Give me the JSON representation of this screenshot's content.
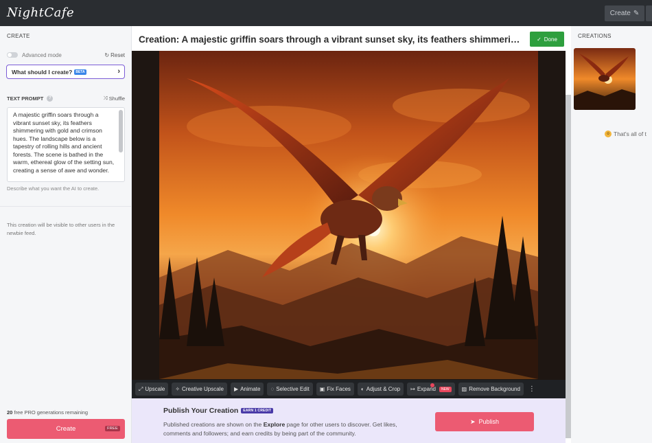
{
  "header": {
    "logo": "NightCafe",
    "create_label": "Create"
  },
  "left_panel": {
    "section_label": "CREATE",
    "advanced_mode_label": "Advanced mode",
    "reset_label": "Reset",
    "what_should_i_create_label": "What should I create?",
    "beta_badge": "BETA",
    "text_prompt_label": "TEXT PROMPT",
    "shuffle_label": "Shuffle",
    "prompt_text": "A majestic griffin soars through a vibrant sunset sky, its feathers shimmering with gold and crimson hues. The landscape below is a tapestry of rolling hills and ancient forests. The scene is bathed in the warm, ethereal glow of the setting sun, creating a sense of awe and wonder.",
    "prompt_hint": "Describe what you want the AI to create.",
    "visibility_note": "This creation will be visible to other users in the newbie feed.",
    "remaining_count": "20",
    "remaining_text": "free PRO generations remaining",
    "create_button_label": "Create",
    "free_tag": "FREE"
  },
  "main": {
    "title": "Creation: A majestic griffin soars through a vibrant sunset sky, its feathers shimmering with gold and crimson hues. The landscape below",
    "done_label": "Done",
    "tools": [
      {
        "label": "Upscale",
        "icon": "upscale-icon"
      },
      {
        "label": "Creative Upscale",
        "icon": "magic-wand-icon"
      },
      {
        "label": "Animate",
        "icon": "video-camera-icon"
      },
      {
        "label": "Selective Edit",
        "icon": "lasso-icon"
      },
      {
        "label": "Fix Faces",
        "icon": "face-frame-icon"
      },
      {
        "label": "Adjust & Crop",
        "icon": "contrast-icon"
      },
      {
        "label": "Expand",
        "icon": "expand-arrow-icon"
      },
      {
        "label": "Remove Background",
        "icon": "image-icon"
      }
    ],
    "new_tag": "NEW",
    "publish": {
      "title": "Publish Your Creation",
      "earn_tag": "EARN 1 CREDIT",
      "desc_before": "Published creations are shown on the ",
      "desc_bold": "Explore",
      "desc_after": " page for other users to discover. Get likes, comments and followers; and earn credits by being part of the community.",
      "button_label": "Publish"
    }
  },
  "right_panel": {
    "section_label": "CREATIONS",
    "end_message": "That's all of t"
  },
  "colors": {
    "accent": "#ec5b72",
    "done_green": "#2e9f3e",
    "topbar": "#2a2d31",
    "publish_bg": "#ebe7fa"
  }
}
